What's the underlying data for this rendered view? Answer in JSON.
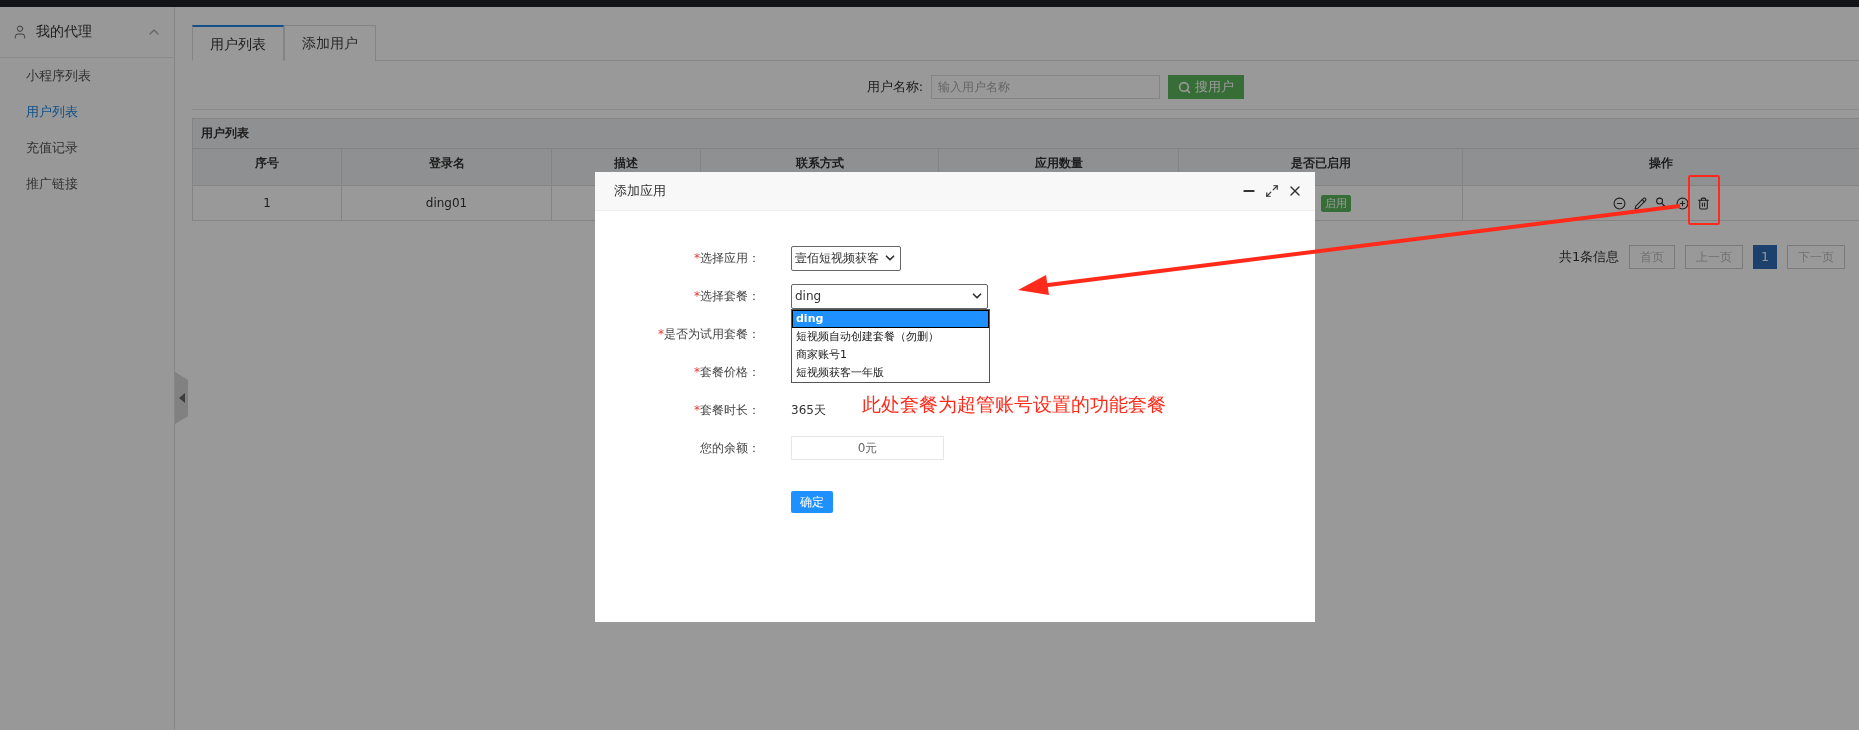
{
  "sidebar": {
    "header": "我的代理",
    "expanded": true,
    "items": [
      {
        "label": "小程序列表",
        "selected": false
      },
      {
        "label": "用户列表",
        "selected": true
      },
      {
        "label": "充值记录",
        "selected": false
      },
      {
        "label": "推广链接",
        "selected": false
      }
    ]
  },
  "tabs": [
    {
      "label": "用户列表",
      "selected": true
    },
    {
      "label": "添加用户",
      "selected": false
    }
  ],
  "search": {
    "label": "用户名称:",
    "placeholder": "输入用户名称",
    "button": "搜用户"
  },
  "table": {
    "title": "用户列表",
    "columns": [
      "序号",
      "登录名",
      "描述",
      "联系方式",
      "应用数量",
      "是否已启用",
      "操作"
    ],
    "rows": [
      {
        "index": "1",
        "login": "ding01",
        "status": "启用"
      }
    ]
  },
  "pagination": {
    "summary": "共1条信息",
    "pages": [
      {
        "label": "首页",
        "selected": false
      },
      {
        "label": "上一页",
        "selected": false
      },
      {
        "label": "1",
        "selected": true
      },
      {
        "label": "下一页",
        "selected": false
      }
    ]
  },
  "dialog": {
    "title": "添加应用",
    "fields": [
      {
        "kind": "select",
        "label": "选择应用：",
        "mark": "*",
        "value": "壹佰短视频获客"
      },
      {
        "kind": "select",
        "label": "选择套餐：",
        "mark": "*",
        "value": "ding",
        "expanded": true,
        "options": [
          {
            "label": "ding",
            "selected": true
          },
          {
            "label": "短视频自动创建套餐（勿删）",
            "selected": false
          },
          {
            "label": "商家账号1",
            "selected": false
          },
          {
            "label": "短视频获客一年版",
            "selected": false
          }
        ]
      },
      {
        "kind": "text",
        "label": "是否为试用套餐：",
        "mark": "*"
      },
      {
        "kind": "text",
        "label": "套餐价格：",
        "mark": "*"
      },
      {
        "kind": "text",
        "label": "套餐时长：",
        "mark": "*",
        "value": "365天"
      },
      {
        "kind": "input",
        "label": "您的余额：",
        "value": "0元"
      }
    ],
    "submit": "确定"
  },
  "annotation": {
    "text": "此处套餐为超管账号设置的功能套餐"
  }
}
